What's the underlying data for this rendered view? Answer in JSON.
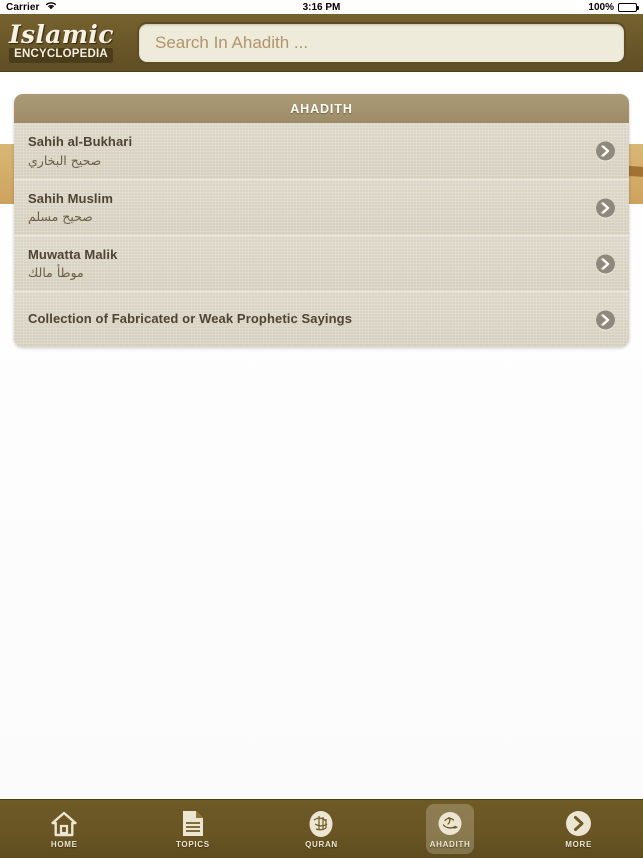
{
  "status_bar": {
    "carrier": "Carrier",
    "wifi_icon": "wifi-icon",
    "time": "3:16 PM",
    "battery_percent": "100%",
    "battery_icon": "battery-full-icon"
  },
  "navbar": {
    "logo_line1": "Islamic",
    "logo_line2": "ENCYCLOPEDIA",
    "search": {
      "placeholder": "Search In Ahadith ...",
      "value": ""
    }
  },
  "panel": {
    "header": "AHADITH",
    "rows": [
      {
        "title": "Sahih al-Bukhari",
        "subtitle": "صحيح البخاري",
        "accessory": "disclosure-chevron-icon"
      },
      {
        "title": "Sahih Muslim",
        "subtitle": "صحيح مسلم",
        "accessory": "disclosure-chevron-icon"
      },
      {
        "title": "Muwatta Malik",
        "subtitle": "موطأ مالك",
        "accessory": "disclosure-chevron-icon"
      },
      {
        "title": "Collection of Fabricated or Weak Prophetic Sayings",
        "subtitle": "",
        "accessory": "disclosure-chevron-icon"
      }
    ]
  },
  "tabbar": {
    "selected": "AHADITH",
    "items": [
      {
        "label": "HOME",
        "icon": "home-icon"
      },
      {
        "label": "TOPICS",
        "icon": "document-icon"
      },
      {
        "label": "QURAN",
        "icon": "quran-medallion-icon"
      },
      {
        "label": "AHADITH",
        "icon": "ahadith-medallion-icon"
      },
      {
        "label": "MORE",
        "icon": "chevron-circle-icon"
      }
    ]
  },
  "colors": {
    "navbar": "#6a5729",
    "tabbar": "#685523",
    "panel_header": "#a3926e",
    "row_background": "#d8d2c2",
    "banner": "#d7b271",
    "search_background": "#efebdb",
    "title_text": "#4e4433"
  }
}
